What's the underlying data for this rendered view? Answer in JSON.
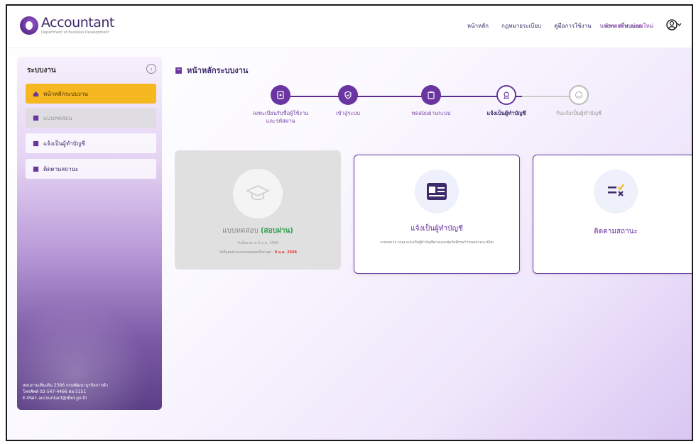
{
  "header": {
    "logo_title": "Accountant",
    "logo_subtitle": "Department of Business Development",
    "nav": [
      "หน้าหลัก",
      "กฎหมายระเบียบ",
      "คู่มือการใช้งาน",
      "ทำการที่พบบ่อย"
    ],
    "user_name": "นายทดสอบ ระบบใหม่"
  },
  "sidebar": {
    "heading": "ระบบงาน",
    "items": [
      {
        "label": "หน้าหลักระบบงาน",
        "state": "active"
      },
      {
        "label": "แบบทดสอบ",
        "state": "disabled"
      },
      {
        "label": "แจ้งเป็นผู้ทำบัญชี",
        "state": "normal"
      },
      {
        "label": "ติดตามสถานะ",
        "state": "normal"
      }
    ],
    "footer_lines": [
      "สอบถามเพิ่มเติม 2566 กรมพัฒนาธุรกิจการค้า",
      "โทรศัพท์ 02-547-4466 ต่อ 5151",
      "E-Mail: accountant@dbd.go.th"
    ]
  },
  "main": {
    "page_title": "หน้าหลักระบบงาน",
    "steps": [
      {
        "label": "ลงทะเบียนรับชื่อผู้ใช้งาน และรหัสผ่าน",
        "state": "done"
      },
      {
        "label": "เข้าสู่ระบบ",
        "state": "done"
      },
      {
        "label": "ทดสอบผ่านระบบ",
        "state": "done"
      },
      {
        "label": "แจ้งเป็นผู้ทำบัญชี",
        "state": "current"
      },
      {
        "label": "รับแจ้งเป็นผู้ทำบัญชี",
        "state": "pending"
      }
    ],
    "cards": {
      "exam": {
        "title": "แบบทดสอบ",
        "status": "(สอบผ่าน)",
        "sub": "วันที่สอบผ่าน 9 ม.ค. 2568",
        "note_prefix": "วันที่สอบผ่านแบบทดสอบครั้งล่าสุด :",
        "note_date": "9 ม.ค. 2568"
      },
      "register": {
        "title": "แจ้งเป็นผู้ทำบัญชี",
        "desc": "ระบบตรวจ กรุณาแจ้งเป็นผู้ทำบัญชีตามแบบฟอร์มที่กรมกำหนดตามระเบียบ"
      },
      "tracking": {
        "title": "ติดตามสถานะ"
      }
    }
  },
  "colors": {
    "primary": "#6a35a0",
    "accent": "#f5b820",
    "pass": "#2e9e4c",
    "alert": "#e0332b"
  }
}
